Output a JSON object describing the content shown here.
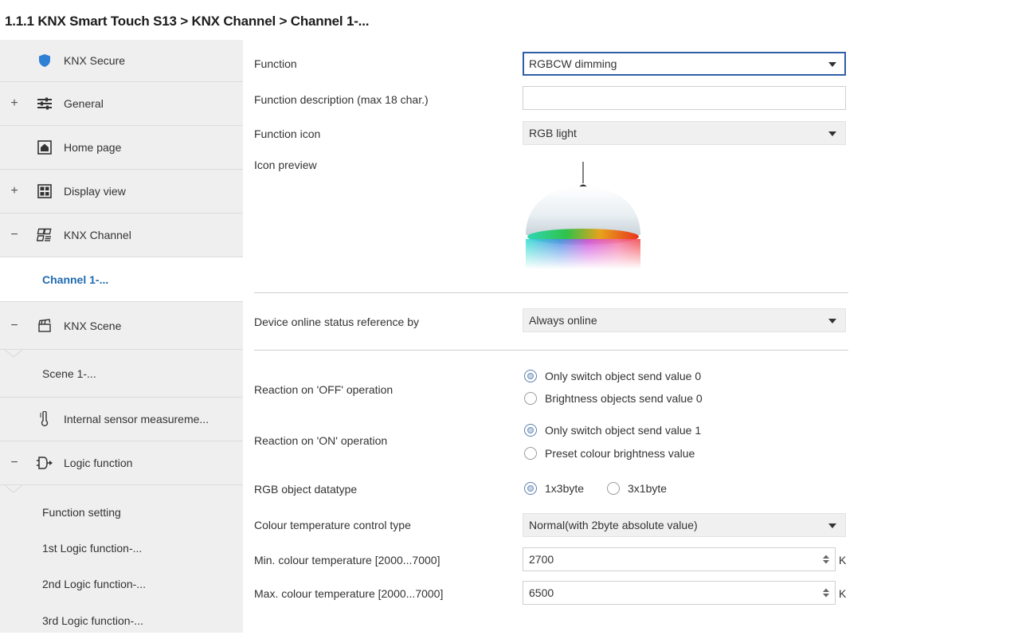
{
  "breadcrumb": "1.1.1 KNX Smart Touch S13 > KNX Channel  > Channel 1-...",
  "sidebar": {
    "items": [
      {
        "label": "KNX Secure",
        "icon": "shield-icon",
        "expander": ""
      },
      {
        "label": "General",
        "icon": "sliders-icon",
        "expander": "+"
      },
      {
        "label": "Home page",
        "icon": "home-icon",
        "expander": ""
      },
      {
        "label": "Display view",
        "icon": "grid-icon",
        "expander": "+"
      },
      {
        "label": "KNX Channel",
        "icon": "channel-icon",
        "expander": "−"
      },
      {
        "label": "Channel 1-...",
        "icon": "",
        "expander": ""
      },
      {
        "label": "KNX Scene",
        "icon": "clapperboard-icon",
        "expander": "−"
      },
      {
        "label": "Scene 1-...",
        "icon": "",
        "expander": ""
      },
      {
        "label": "Internal sensor measureme...",
        "icon": "thermometer-icon",
        "expander": ""
      },
      {
        "label": "Logic function",
        "icon": "logic-gate-icon",
        "expander": "−"
      },
      {
        "label": "Function setting",
        "icon": "",
        "expander": ""
      },
      {
        "label": "1st Logic function-...",
        "icon": "",
        "expander": ""
      },
      {
        "label": "2nd Logic function-...",
        "icon": "",
        "expander": ""
      },
      {
        "label": "3rd Logic function-...",
        "icon": "",
        "expander": ""
      }
    ]
  },
  "form": {
    "function_label": "Function",
    "function_value": "RGBCW dimming",
    "description_label": "Function description (max 18 char.)",
    "description_value": "",
    "icon_label": "Function icon",
    "icon_value": "RGB light",
    "preview_label": "Icon preview",
    "online_label": "Device online status reference by",
    "online_value": "Always online",
    "off_label": "Reaction on 'OFF' operation",
    "off_options": [
      "Only switch object send value 0",
      "Brightness objects send value 0"
    ],
    "off_selected": 0,
    "on_label": "Reaction on 'ON' operation",
    "on_options": [
      "Only switch object send value 1",
      "Preset colour brightness value"
    ],
    "on_selected": 0,
    "rgb_label": "RGB object datatype",
    "rgb_options": [
      "1x3byte",
      "3x1byte"
    ],
    "rgb_selected": 0,
    "ct_type_label": "Colour temperature control type",
    "ct_type_value": "Normal(with 2byte absolute value)",
    "min_ct_label": "Min. colour temperature [2000...7000]",
    "min_ct_value": "2700",
    "max_ct_label": "Max. colour temperature [2000...7000]",
    "max_ct_value": "6500",
    "unit": "K"
  },
  "colors": {
    "accent": "#1f6ab0",
    "focus_border": "#2f5ea8",
    "sidebar_bg": "#efefef"
  }
}
